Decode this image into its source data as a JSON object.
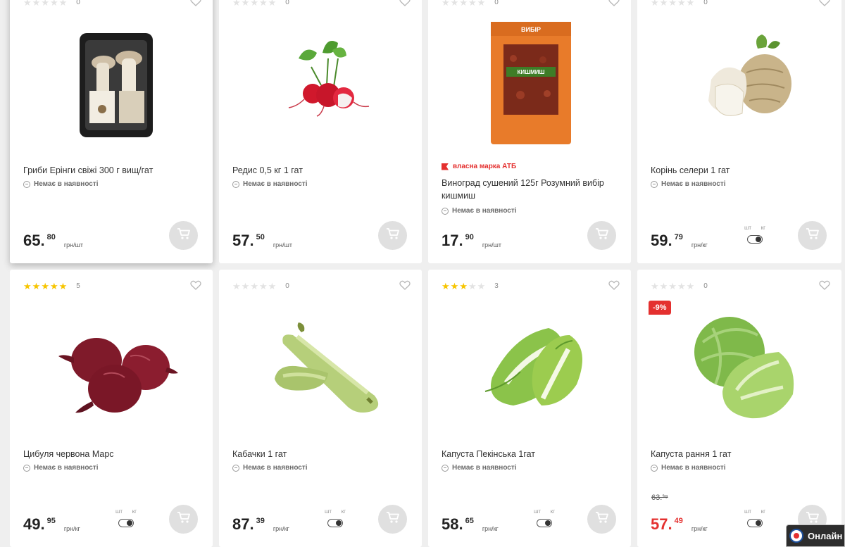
{
  "products": [
    {
      "rating": 0,
      "reviews": "0",
      "title": "Гриби Ерінги свіжі 300 г вищ/гат",
      "stock": "Немає в наявності",
      "price_int": "65",
      "price_frac": "80",
      "unit": "грн/шт",
      "image": "mushroom-pack"
    },
    {
      "rating": 0,
      "reviews": "0",
      "title": "Редис 0,5 кг 1 гат",
      "stock": "Немає в наявності",
      "price_int": "57",
      "price_frac": "50",
      "unit": "грн/шт",
      "image": "radish"
    },
    {
      "rating": 0,
      "reviews": "0",
      "brand": "власна марка АТБ",
      "title": "Виноград сушений 125г Розумний вибір кишмиш",
      "stock": "Немає в наявності",
      "price_int": "17",
      "price_frac": "90",
      "unit": "грн/шт",
      "image": "raisins-pack"
    },
    {
      "rating": 0,
      "reviews": "0",
      "title": "Корінь селери 1 гат",
      "stock": "Немає в наявності",
      "price_int": "59",
      "price_frac": "79",
      "unit": "грн/кг",
      "toggle": {
        "left": "шт",
        "right": "кг"
      },
      "image": "celery-root"
    },
    {
      "rating": 5,
      "reviews": "5",
      "title": "Цибуля червона Марс",
      "stock": "Немає в наявності",
      "price_int": "49",
      "price_frac": "95",
      "unit": "грн/кг",
      "toggle": {
        "left": "шт",
        "right": "кг"
      },
      "image": "red-onion"
    },
    {
      "rating": 0,
      "reviews": "0",
      "title": "Кабачки 1 гат",
      "stock": "Немає в наявності",
      "price_int": "87",
      "price_frac": "39",
      "unit": "грн/кг",
      "toggle": {
        "left": "шт",
        "right": "кг"
      },
      "image": "zucchini"
    },
    {
      "rating": 3,
      "reviews": "3",
      "title": "Капуста Пекінська 1гат",
      "stock": "Немає в наявності",
      "price_int": "58",
      "price_frac": "65",
      "unit": "грн/кг",
      "toggle": {
        "left": "шт",
        "right": "кг"
      },
      "image": "napa-cabbage"
    },
    {
      "rating": 0,
      "reviews": "0",
      "badge": "-9%",
      "title": "Капуста рання 1 гат",
      "stock": "Немає в наявності",
      "old_price": "63.³⁹",
      "price_int": "57",
      "price_frac": "49",
      "unit": "грн/кг",
      "toggle": {
        "left": "шт",
        "right": "кг"
      },
      "image": "cabbage",
      "sale": true
    }
  ],
  "online_button": "Онлайн",
  "colors": {
    "accent_red": "#e4302f",
    "star": "#f7c500",
    "background": "#efefef"
  }
}
